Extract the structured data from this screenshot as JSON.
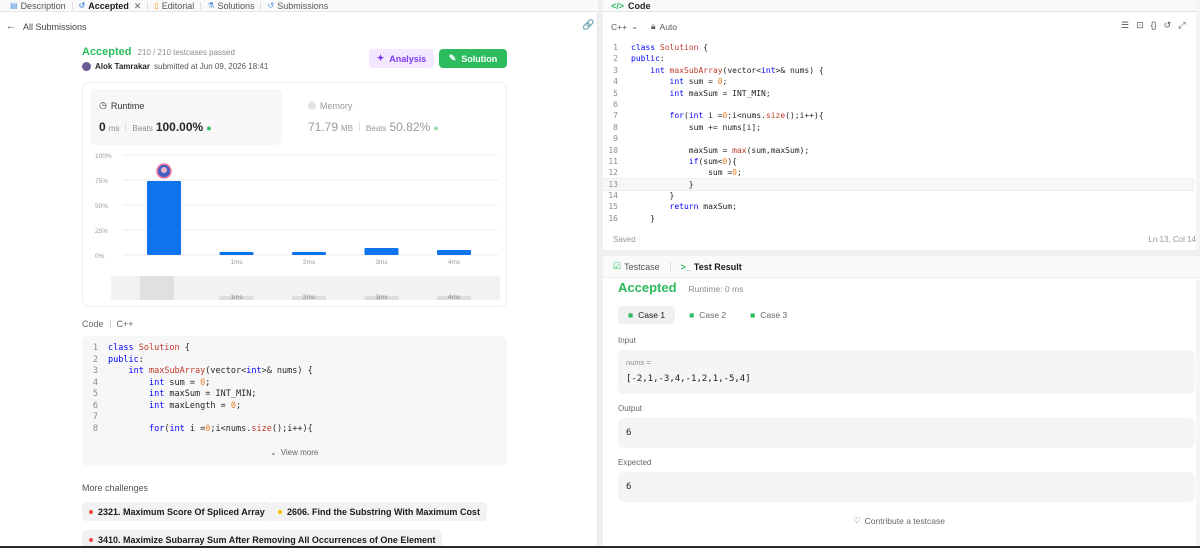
{
  "tabs": [
    {
      "label": "Description",
      "icon": "description-icon",
      "active": false
    },
    {
      "label": "Accepted",
      "icon": "accepted-icon",
      "active": true
    },
    {
      "label": "Editorial",
      "icon": "editorial-icon",
      "active": false
    },
    {
      "label": "Solutions",
      "icon": "solutions-icon",
      "active": false
    },
    {
      "label": "Submissions",
      "icon": "submissions-icon",
      "active": false
    }
  ],
  "back_label": "All Submissions",
  "submission": {
    "status": "Accepted",
    "testcases": "210 / 210 testcases passed",
    "author": "Alok Tamrakar",
    "submitted_text": "submitted at Jun 09, 2026 18:41",
    "analysis_label": "Analysis",
    "solution_label": "Solution"
  },
  "runtime": {
    "title": "Runtime",
    "value": "0",
    "unit": "ms",
    "beats_label": "Beats",
    "beats_value": "100.00%"
  },
  "memory": {
    "title": "Memory",
    "value": "71.79",
    "unit": "MB",
    "beats_label": "Beats",
    "beats_value": "50.82%"
  },
  "chart_data": {
    "type": "bar",
    "categories": [
      "",
      "1ms",
      "2ms",
      "3ms",
      "4ms"
    ],
    "values": [
      74,
      3,
      3,
      7,
      5
    ],
    "ylim": [
      0,
      100
    ],
    "yticks": [
      "100%",
      "75%",
      "50%",
      "25%",
      "0%"
    ],
    "grid": true,
    "colors": {
      "bar": "#0d74ee"
    },
    "range_labels": [
      "1ms",
      "2ms",
      "3ms",
      "4ms"
    ]
  },
  "code_section": {
    "label": "Code",
    "language": "C++",
    "view_more": "View more",
    "lines": [
      {
        "n": "1",
        "text": "class Solution {"
      },
      {
        "n": "2",
        "text": "public:"
      },
      {
        "n": "3",
        "text": "    int maxSubArray(vector<int>& nums) {"
      },
      {
        "n": "4",
        "text": "        int sum = 0;"
      },
      {
        "n": "5",
        "text": "        int maxSum = INT_MIN;"
      },
      {
        "n": "6",
        "text": "        int maxLength = 0;"
      },
      {
        "n": "7",
        "text": ""
      },
      {
        "n": "8",
        "text": "        for(int i =0;i<nums.size();i++){"
      }
    ]
  },
  "more_challenges": {
    "title": "More challenges",
    "items": [
      {
        "label": "2321. Maximum Score Of Spliced Array",
        "color": "#ef4743"
      },
      {
        "label": "2606. Find the Substring With Maximum Cost",
        "color": "#ffb800"
      },
      {
        "label": "3410. Maximize Subarray Sum After Removing All Occurrences of One Element",
        "color": "#ef4743"
      }
    ]
  },
  "editor": {
    "title": "Code",
    "language": "C++",
    "mode": "Auto",
    "saved": "Saved",
    "cursor": "Ln 13, Col 14",
    "lines": [
      {
        "n": "1",
        "text": "class Solution {"
      },
      {
        "n": "2",
        "text": "public:"
      },
      {
        "n": "3",
        "text": "    int maxSubArray(vector<int>& nums) {"
      },
      {
        "n": "4",
        "text": "        int sum = 0;"
      },
      {
        "n": "5",
        "text": "        int maxSum = INT_MIN;"
      },
      {
        "n": "6",
        "text": ""
      },
      {
        "n": "7",
        "text": "        for(int i =0;i<nums.size();i++){"
      },
      {
        "n": "8",
        "text": "            sum += nums[i];"
      },
      {
        "n": "9",
        "text": ""
      },
      {
        "n": "10",
        "text": "            maxSum = max(sum,maxSum);"
      },
      {
        "n": "11",
        "text": "            if(sum<0){"
      },
      {
        "n": "12",
        "text": "                sum =0;"
      },
      {
        "n": "13",
        "text": "            }"
      },
      {
        "n": "14",
        "text": "        }"
      },
      {
        "n": "15",
        "text": "        return maxSum;"
      },
      {
        "n": "16",
        "text": "    }"
      }
    ]
  },
  "test": {
    "tab_testcase": "Testcase",
    "tab_result": "Test Result",
    "status": "Accepted",
    "runtime": "Runtime: 0 ms",
    "cases": [
      "Case 1",
      "Case 2",
      "Case 3"
    ],
    "input_label": "Input",
    "input_var": "nums =",
    "input_value": "[-2,1,-3,4,-1,2,1,-5,4]",
    "output_label": "Output",
    "output_value": "6",
    "expected_label": "Expected",
    "expected_value": "6",
    "contribute": "Contribute a testcase"
  }
}
